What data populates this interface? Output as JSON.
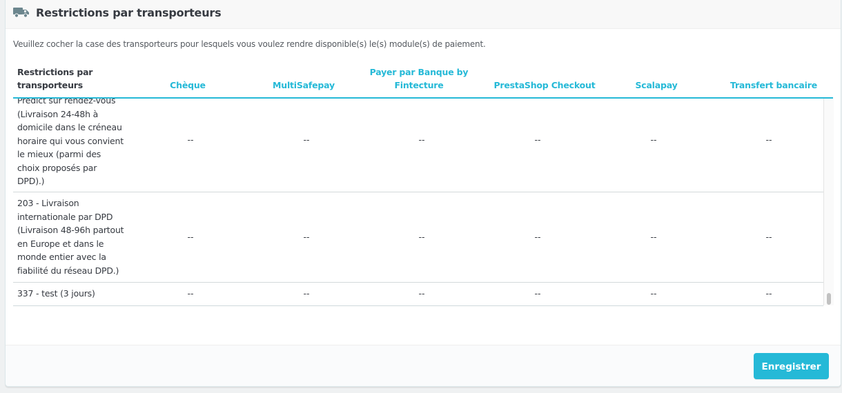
{
  "panel": {
    "title": "Restrictions par transporteurs",
    "header_icon": "truck-icon",
    "description": "Veuillez cocher la case des transporteurs pour lesquels vous voulez rendre disponible(s) le(s) module(s) de paiement."
  },
  "table": {
    "first_header_line1": "Restrictions par",
    "first_header_line2": "transporteurs",
    "columns": [
      {
        "line1": "",
        "line2": "Chèque"
      },
      {
        "line1": "",
        "line2": "MultiSafepay"
      },
      {
        "line1": "Payer par Banque by",
        "line2": "Fintecture"
      },
      {
        "line1": "",
        "line2": "PrestaShop Checkout"
      },
      {
        "line1": "",
        "line2": "Scalapay"
      },
      {
        "line1": "",
        "line2": "Transfert bancaire"
      }
    ],
    "rows": [
      {
        "name_lines": [
          "Predict sur rendez-vous",
          "(Livraison 24-48h à",
          "domicile dans le créneau",
          "horaire qui vous convient",
          "le mieux (parmi des",
          "choix proposés par",
          "DPD).)"
        ],
        "values": [
          "--",
          "--",
          "--",
          "--",
          "--",
          "--"
        ]
      },
      {
        "name_lines": [
          "203 - Livraison",
          "internationale par DPD",
          "(Livraison 48-96h partout",
          "en Europe et dans le",
          "monde entier avec la",
          "fiabilité du réseau DPD.)"
        ],
        "values": [
          "--",
          "--",
          "--",
          "--",
          "--",
          "--"
        ]
      },
      {
        "name_lines": [
          "337 - test (3 jours)"
        ],
        "values": [
          "--",
          "--",
          "--",
          "--",
          "--",
          "--"
        ]
      }
    ]
  },
  "footer": {
    "save_label": "Enregistrer"
  },
  "colors": {
    "accent": "#25b9d7",
    "text": "#363a41"
  }
}
